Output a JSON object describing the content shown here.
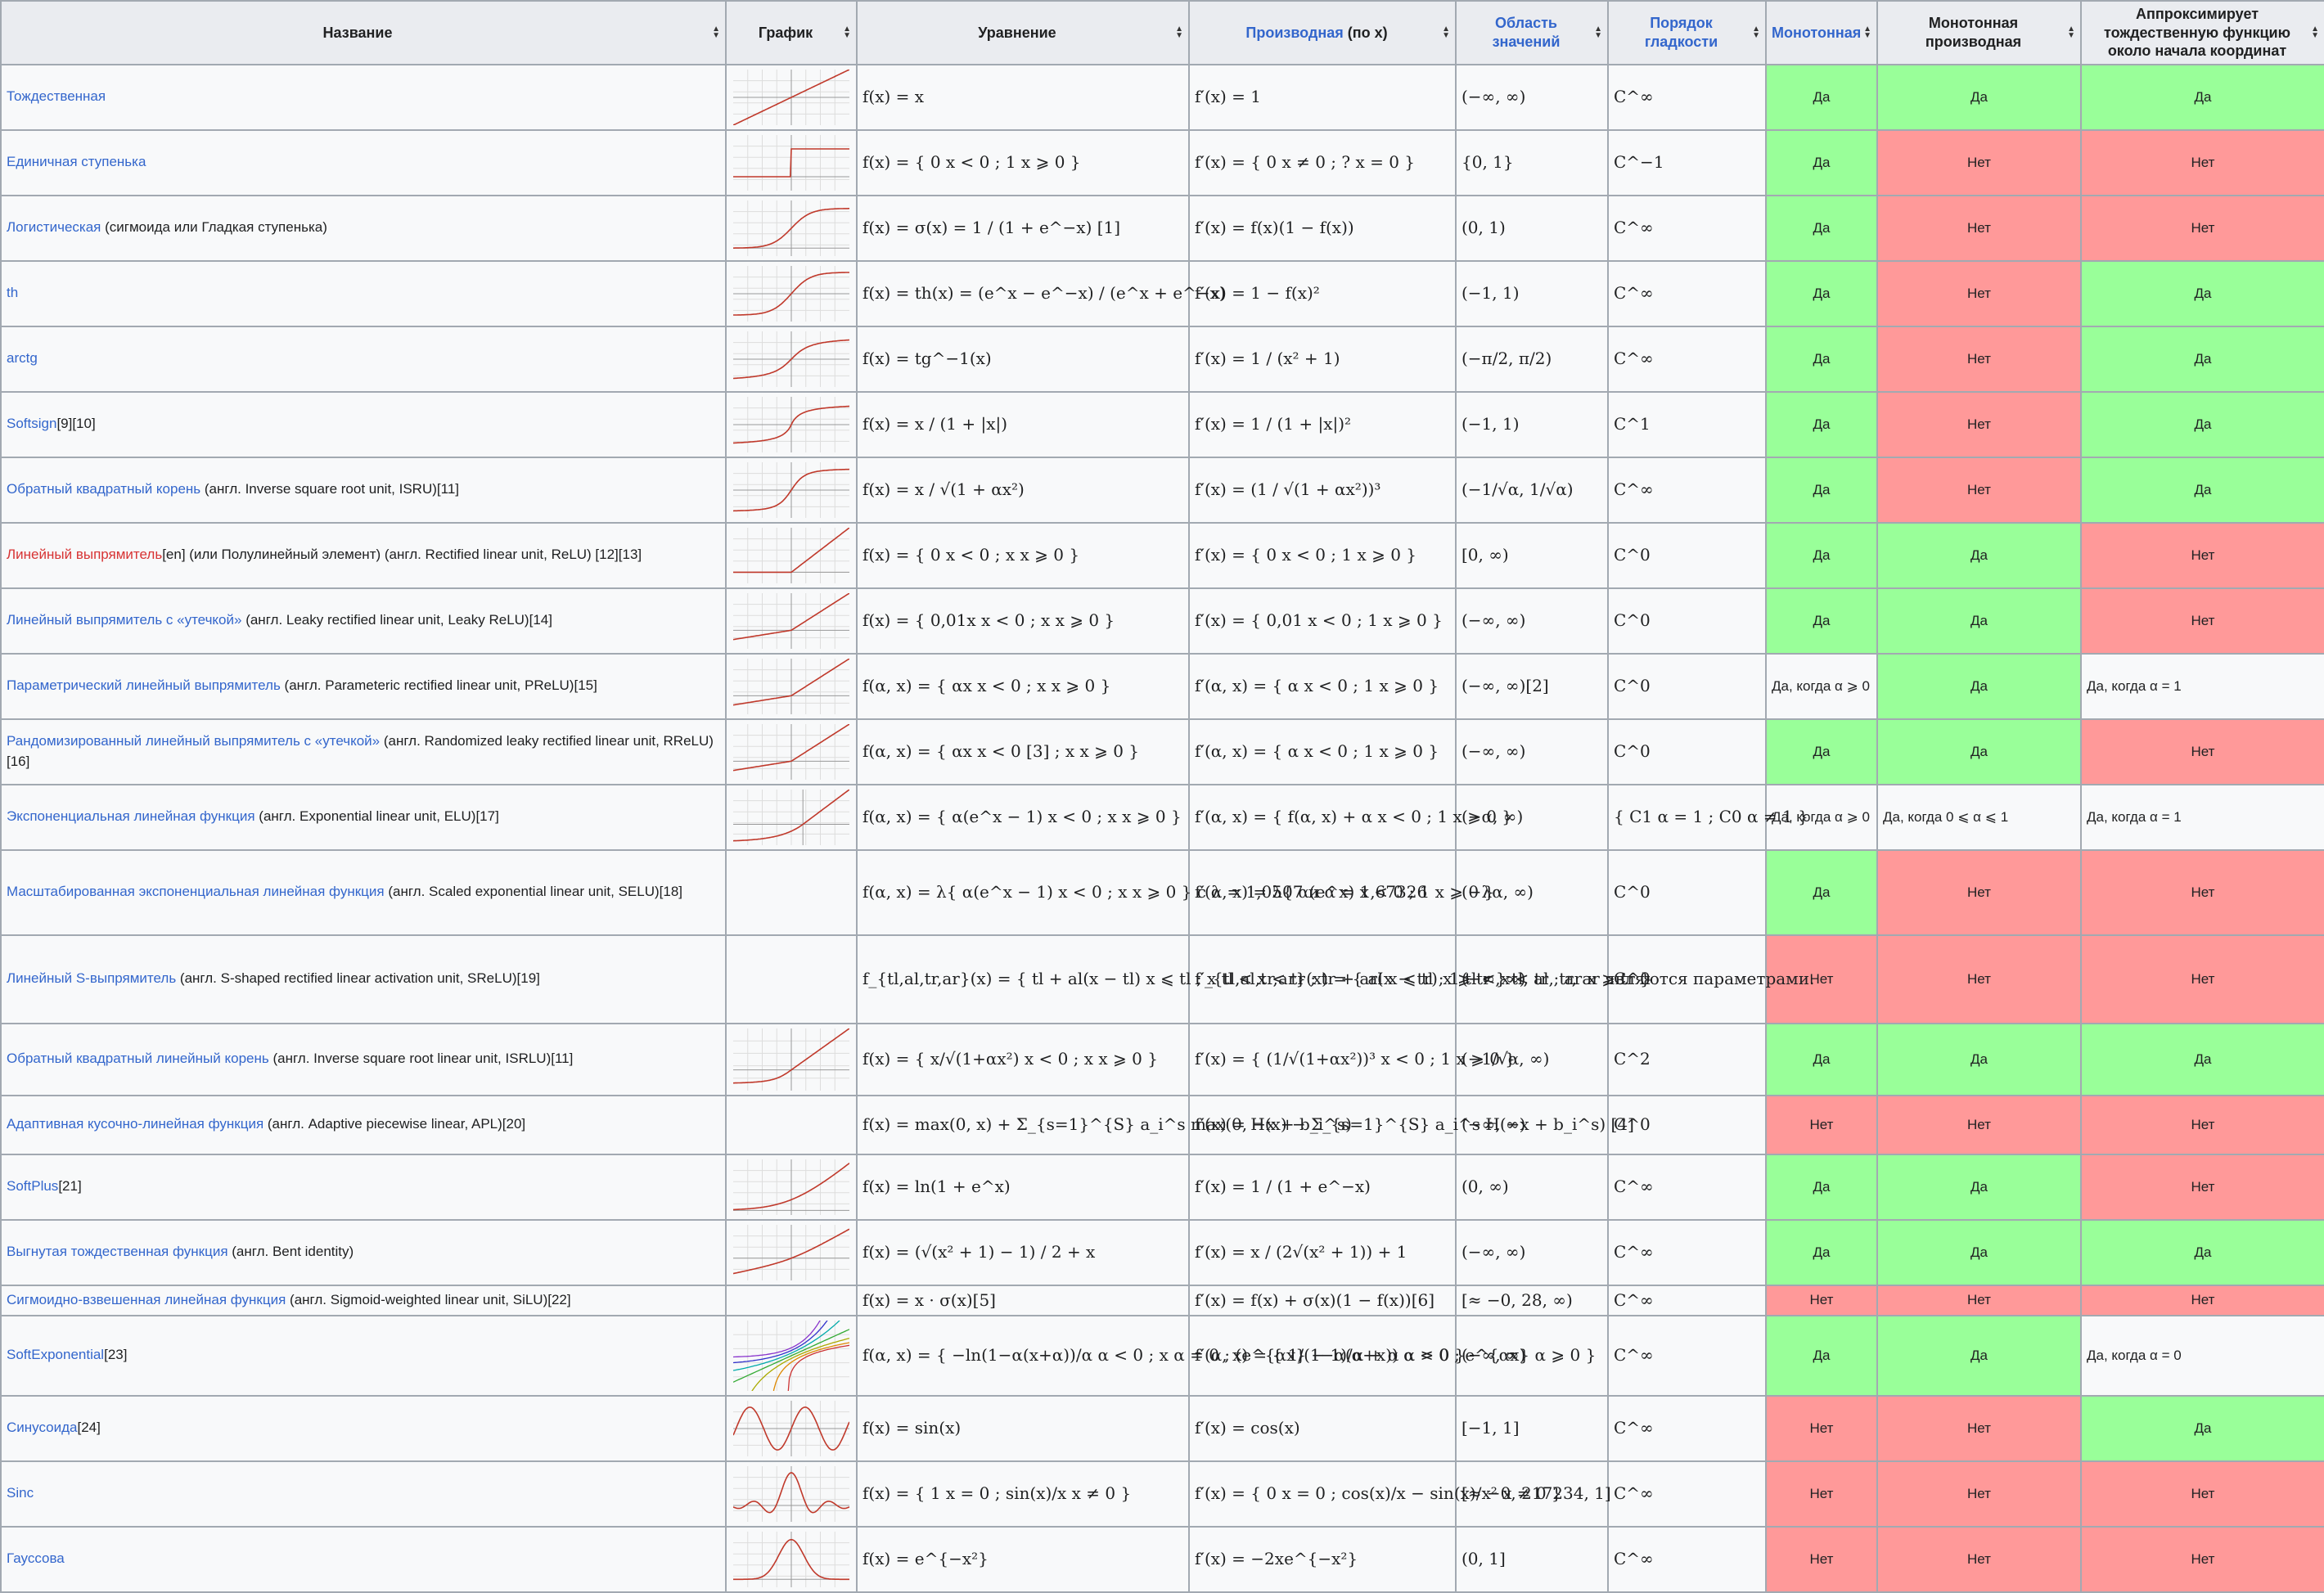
{
  "headers": [
    {
      "label": "Название"
    },
    {
      "label": "График"
    },
    {
      "label": "Уравнение"
    },
    {
      "label": "Производная",
      "suffix": " (по x)"
    },
    {
      "label": "Область значений"
    },
    {
      "label": "Порядок гладкости"
    },
    {
      "label": "Монотонная"
    },
    {
      "label": "Монотонная производная"
    },
    {
      "label": "Аппроксимирует тождественную функцию около начала координат"
    }
  ],
  "rows": [
    {
      "name": "Тождественная",
      "note": "",
      "eq": "f(x) = x",
      "der": "f′(x) = 1",
      "range": "(−∞, ∞)",
      "smooth": "C^∞",
      "mono": "Да",
      "mono_d": "Да",
      "approx": "Да",
      "graph": "identity"
    },
    {
      "name": "Единичная ступенька",
      "note": "",
      "eq": "f(x) = { 0  x < 0 ; 1  x ⩾ 0 }",
      "der": "f′(x) = { 0  x ≠ 0 ; ?  x = 0 }",
      "range": "{0, 1}",
      "smooth": "C^−1",
      "mono": "Да",
      "mono_d": "Нет",
      "approx": "Нет",
      "graph": "step"
    },
    {
      "name": "Логистическая",
      "note": " (сигмоида или Гладкая ступенька)",
      "eq": "f(x) = σ(x) = 1 / (1 + e^−x) [1]",
      "der": "f′(x) = f(x)(1 − f(x))",
      "range": "(0, 1)",
      "smooth": "C^∞",
      "mono": "Да",
      "mono_d": "Нет",
      "approx": "Нет",
      "graph": "sigmoid"
    },
    {
      "name": "th",
      "note": "",
      "eq": "f(x) = th(x) = (e^x − e^−x) / (e^x + e^−x)",
      "der": "f′(x) = 1 − f(x)²",
      "range": "(−1, 1)",
      "smooth": "C^∞",
      "mono": "Да",
      "mono_d": "Нет",
      "approx": "Да",
      "graph": "tanh"
    },
    {
      "name": "arctg",
      "note": "",
      "eq": "f(x) = tg^−1(x)",
      "der": "f′(x) = 1 / (x² + 1)",
      "range": "(−π/2, π/2)",
      "smooth": "C^∞",
      "mono": "Да",
      "mono_d": "Нет",
      "approx": "Да",
      "graph": "atan"
    },
    {
      "name": "Softsign",
      "note": "[9][10]",
      "eq": "f(x) = x / (1 + |x|)",
      "der": "f′(x) = 1 / (1 + |x|)²",
      "range": "(−1, 1)",
      "smooth": "C^1",
      "mono": "Да",
      "mono_d": "Нет",
      "approx": "Да",
      "graph": "softsign"
    },
    {
      "name": "Обратный квадратный корень",
      "note": " (англ. Inverse square root unit, ISRU)[11]",
      "eq": "f(x) = x / √(1 + αx²)",
      "der": "f′(x) = (1 / √(1 + αx²))³",
      "range": "(−1/√α, 1/√α)",
      "smooth": "C^∞",
      "mono": "Да",
      "mono_d": "Нет",
      "approx": "Да",
      "graph": "isru"
    },
    {
      "name": "Линейный выпрямитель",
      "note": "[en] (или Полулинейный элемент) (англ. Rectified linear unit, ReLU) [12][13]",
      "eq": "f(x) = { 0  x < 0 ; x  x ⩾ 0 }",
      "der": "f′(x) = { 0  x < 0 ; 1  x ⩾ 0 }",
      "range": "[0, ∞)",
      "smooth": "C^0",
      "mono": "Да",
      "mono_d": "Да",
      "approx": "Нет",
      "graph": "relu",
      "red": true
    },
    {
      "name": "Линейный выпрямитель с «утечкой»",
      "note": " (англ. Leaky rectified linear unit, Leaky ReLU)[14]",
      "eq": "f(x) = { 0,01x  x < 0 ; x  x ⩾ 0 }",
      "der": "f′(x) = { 0,01  x < 0 ; 1  x ⩾ 0 }",
      "range": "(−∞, ∞)",
      "smooth": "C^0",
      "mono": "Да",
      "mono_d": "Да",
      "approx": "Нет",
      "graph": "leaky"
    },
    {
      "name": "Параметрический линейный выпрямитель",
      "note": " (англ. Parameteric rectified linear unit, PReLU)[15]",
      "eq": "f(α, x) = { αx  x < 0 ; x  x ⩾ 0 }",
      "der": "f′(α, x) = { α  x < 0 ; 1  x ⩾ 0 }",
      "range": "(−∞, ∞)[2]",
      "smooth": "C^0",
      "mono": "Да, когда α ⩾ 0",
      "mono_d": "Да",
      "approx": "Да, когда α = 1",
      "graph": "leaky"
    },
    {
      "name": "Рандомизированный линейный выпрямитель с «утечкой»",
      "note": " (англ. Randomized leaky rectified linear unit, RReLU)[16]",
      "eq": "f(α, x) = { αx  x < 0 [3] ; x  x ⩾ 0 }",
      "der": "f′(α, x) = { α  x < 0 ; 1  x ⩾ 0 }",
      "range": "(−∞, ∞)",
      "smooth": "C^0",
      "mono": "Да",
      "mono_d": "Да",
      "approx": "Нет",
      "graph": "leaky"
    },
    {
      "name": "Экспоненциальная линейная функция",
      "note": " (англ. Exponential linear unit, ELU)[17]",
      "eq": "f(α, x) = { α(e^x − 1)  x < 0 ; x  x ⩾ 0 }",
      "der": "f′(α, x) = { f(α, x) + α  x < 0 ; 1  x ⩾ 0 }",
      "range": "(−α, ∞)",
      "smooth": "{ C1  α = 1 ; C0  α ≠ 1 }",
      "mono": "Да, когда α ⩾ 0",
      "mono_d": "Да, когда 0 ⩽ α ⩽ 1",
      "approx": "Да, когда α = 1",
      "graph": "elu"
    },
    {
      "name": "Масштабированная экспоненциальная линейная функция",
      "note": " (англ. Scaled exponential linear unit, SELU)[18]",
      "eq": "f(α, x) = λ{ α(e^x − 1)  x < 0 ; x  x ⩾ 0 }  с λ = 1,0507 и α = 1,67326",
      "der": "f′(α, x) = λ{ α(e^x)  x < 0 ; 1  x ⩾ 0 }",
      "range": "(−λα, ∞)",
      "smooth": "C^0",
      "mono": "Да",
      "mono_d": "Нет",
      "approx": "Нет",
      "graph": "none"
    },
    {
      "name": "Линейный S-выпрямитель",
      "note": " (англ. S-shaped rectified linear activation unit, SReLU)[19]",
      "eq": "f_{tl,al,tr,ar}(x) = { tl + al(x − tl)  x ⩽ tl ; x  tl < x < tr ; tr + ar(x − tr)  x ⩾ tr }  tl, al, tr, ar являются параметрами.",
      "der": "f′_{tl,al,tr,ar}(x) = { al  x ⩽ tl ; 1  tl < x < tr ; ar  x ⩾ tr }",
      "range": "(−∞, ∞)",
      "smooth": "C^0",
      "mono": "Нет",
      "mono_d": "Нет",
      "approx": "Нет",
      "graph": "none"
    },
    {
      "name": "Обратный квадратный линейный корень",
      "note": " (англ. Inverse square root linear unit, ISRLU)[11]",
      "eq": "f(x) = { x/√(1+αx²)  x < 0 ; x  x ⩾ 0 }",
      "der": "f′(x) = { (1/√(1+αx²))³  x < 0 ; 1  x ⩾ 0 }",
      "range": "(−1/√α, ∞)",
      "smooth": "C^2",
      "mono": "Да",
      "mono_d": "Да",
      "approx": "Да",
      "graph": "isrlu"
    },
    {
      "name": "Адаптивная кусочно-линейная функция",
      "note": " (англ. Adaptive piecewise linear, APL)[20]",
      "eq": "f(x) = max(0, x) + Σ_{s=1}^{S} a_i^s max(0, −x + b_i^s)",
      "der": "f′(x) = H(x) − Σ_{s=1}^{S} a_i^s H(−x + b_i^s) [4]",
      "range": "(−∞, ∞)",
      "smooth": "C^0",
      "mono": "Нет",
      "mono_d": "Нет",
      "approx": "Нет",
      "graph": "none"
    },
    {
      "name": "SoftPlus",
      "note": "[21]",
      "eq": "f(x) = ln(1 + e^x)",
      "der": "f′(x) = 1 / (1 + e^−x)",
      "range": "(0, ∞)",
      "smooth": "C^∞",
      "mono": "Да",
      "mono_d": "Да",
      "approx": "Нет",
      "graph": "softplus"
    },
    {
      "name": "Выгнутая тождественная функция",
      "note": " (англ. Bent identity)",
      "eq": "f(x) = (√(x² + 1) − 1) / 2 + x",
      "der": "f′(x) = x / (2√(x² + 1)) + 1",
      "range": "(−∞, ∞)",
      "smooth": "C^∞",
      "mono": "Да",
      "mono_d": "Да",
      "approx": "Да",
      "graph": "bent"
    },
    {
      "name": "Сигмоидно-взвешенная линейная функция",
      "note": " (англ. Sigmoid-weighted linear unit, SiLU)[22]",
      "eq": "f(x) = x · σ(x)[5]",
      "der": "f′(x) = f(x) + σ(x)(1 − f(x))[6]",
      "range": "[≈ −0, 28, ∞)",
      "smooth": "C^∞",
      "mono": "Нет",
      "mono_d": "Нет",
      "approx": "Нет",
      "graph": "none",
      "thin": true
    },
    {
      "name": "SoftExponential",
      "note": "[23]",
      "eq": "f(α, x) = { −ln(1−α(x+α))/α  α < 0 ; x  α = 0 ; (e^{αx} − 1)/α + α  α > 0 }",
      "der": "f′(α, x) = { 1/(1−α(α+x))  α < 0 ; e^{αx}  α ⩾ 0 }",
      "range": "(−∞, ∞)",
      "smooth": "C^∞",
      "mono": "Да",
      "mono_d": "Да",
      "approx": "Да, когда α = 0",
      "graph": "softexp"
    },
    {
      "name": "Синусоида",
      "note": "[24]",
      "eq": "f(x) = sin(x)",
      "der": "f′(x) = cos(x)",
      "range": "[−1, 1]",
      "smooth": "C^∞",
      "mono": "Нет",
      "mono_d": "Нет",
      "approx": "Да",
      "graph": "sin"
    },
    {
      "name": "Sinc",
      "note": "",
      "eq": "f(x) = { 1  x = 0 ; sin(x)/x  x ≠ 0 }",
      "der": "f′(x) = { 0  x = 0 ; cos(x)/x − sin(x)/x²  x ≠ 0 }",
      "range": "[≈ −0, 217234, 1]",
      "smooth": "C^∞",
      "mono": "Нет",
      "mono_d": "Нет",
      "approx": "Нет",
      "graph": "sinc"
    },
    {
      "name": "Гауссова",
      "note": "",
      "eq": "f(x) = e^{−x²}",
      "der": "f′(x) = −2xe^{−x²}",
      "range": "(0, 1]",
      "smooth": "C^∞",
      "mono": "Нет",
      "mono_d": "Нет",
      "approx": "Нет",
      "graph": "gauss"
    }
  ],
  "colors": {
    "yes": "#99ff99",
    "no": "#ff9999",
    "link": "#3366cc",
    "header_bg": "#eaecf0",
    "border": "#a2a9b1"
  }
}
